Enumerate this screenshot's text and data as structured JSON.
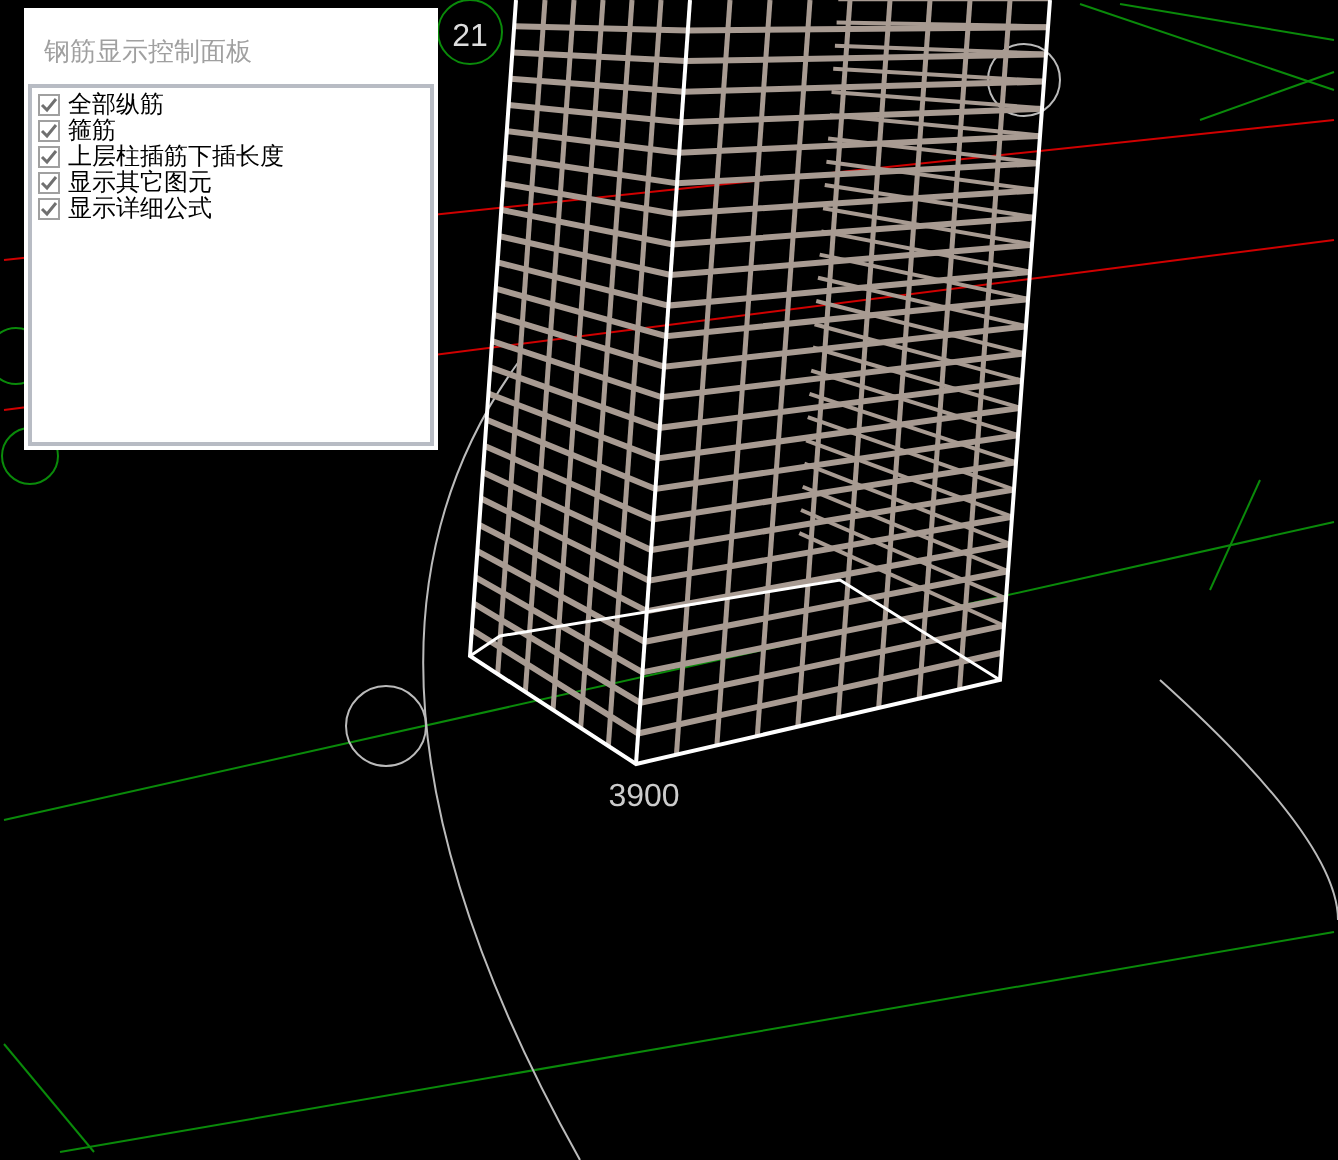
{
  "panel": {
    "title": "钢筋显示控制面板",
    "options": [
      {
        "label": "全部纵筋",
        "checked": true
      },
      {
        "label": "箍筋",
        "checked": true
      },
      {
        "label": "上层柱插筋下插长度",
        "checked": true
      },
      {
        "label": "显示其它图元",
        "checked": true
      },
      {
        "label": "显示详细公式",
        "checked": true
      }
    ]
  },
  "axis_labels": [
    "21"
  ],
  "dimension": "3900"
}
